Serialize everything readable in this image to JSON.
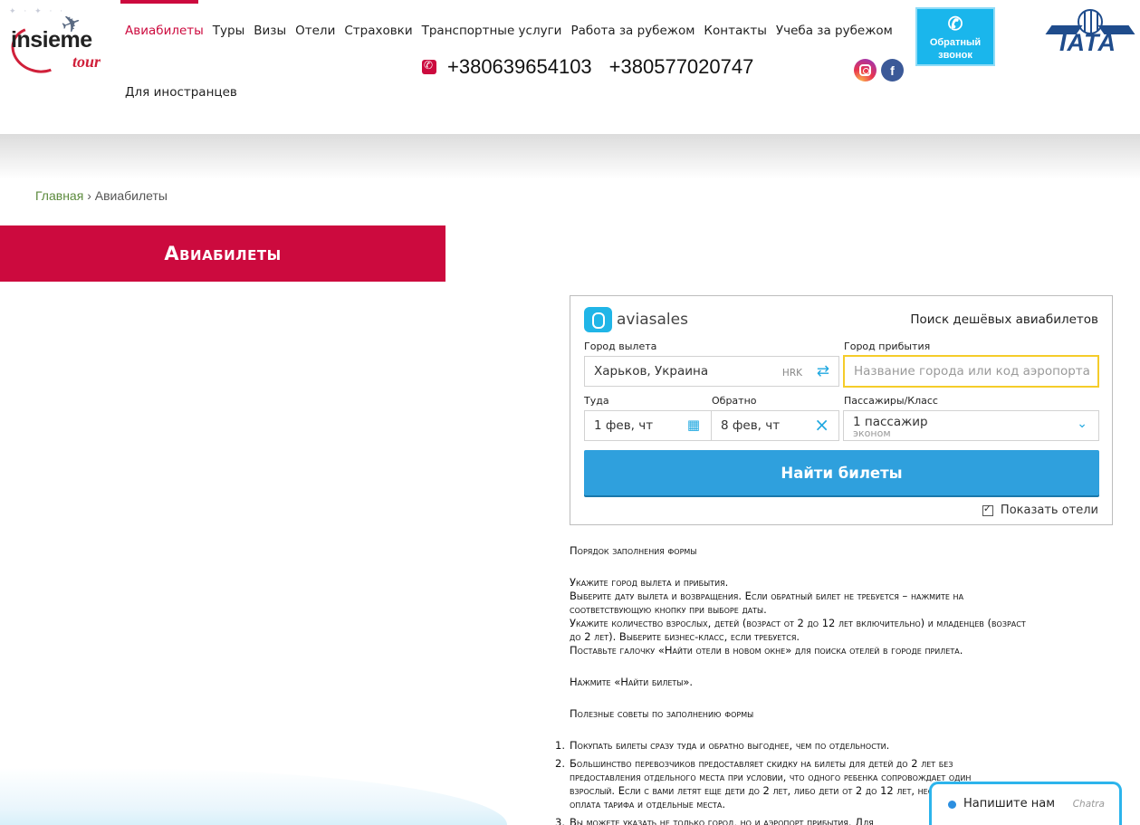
{
  "header": {
    "logo": {
      "brand": "insieme",
      "brand2": "tour"
    },
    "nav": [
      {
        "label": "Авиабилеты",
        "active": true
      },
      {
        "label": "Туры"
      },
      {
        "label": "Визы"
      },
      {
        "label": "Отели"
      },
      {
        "label": "Страховки"
      },
      {
        "label": "Транспортные услуги"
      },
      {
        "label": "Работа за рубежом"
      },
      {
        "label": "Контакты"
      },
      {
        "label": "Учеба за рубежом"
      }
    ],
    "nav_second_row": "Для иностранцев",
    "phones": [
      "+380639654103",
      "+380577020747"
    ],
    "callback": {
      "line1": "Обратный",
      "line2": "звонок"
    },
    "iata_label": "IATA",
    "colors": {
      "accent": "#cc0a3e",
      "callback": "#1ab6ec",
      "iata": "#1f4c8c"
    }
  },
  "breadcrumb": {
    "home": "Главная",
    "separator": "›",
    "current": "Авиабилеты"
  },
  "page_title": "Авиабилеты",
  "widget": {
    "brand": "aviasales",
    "tagline": "Поиск дешёвых авиабилетов",
    "from_label": "Город вылета",
    "from_value": "Харьков, Украина",
    "from_code": "HRK",
    "to_label": "Город прибытия",
    "to_placeholder": "Название города или код аэропорта",
    "depart_label": "Туда",
    "depart_value": "1 фев, чт",
    "return_label": "Обратно",
    "return_value": "8 фев, чт",
    "pax_label": "Пассажиры/Класс",
    "pax_value": "1 пассажир",
    "pax_class": "эконом",
    "search_button": "Найти билеты",
    "show_hotels": "Показать отели",
    "colors": {
      "button": "#2fa0dd",
      "focus_border": "#f5cc2a",
      "icon": "#20a8e0"
    }
  },
  "instructions": {
    "heading": "Порядок заполнения формы",
    "steps": [
      "Укажите город вылета и прибытия.",
      "Выберите дату вылета и возвращения. Если обратный билет не требуется – нажмите на",
      "соответствующую кнопку при выборе даты.",
      "Укажите количество взрослых, детей (возраст от 2 до 12 лет включительно) и младенцев (возраст",
      "до 2 лет). Выберите бизнес-класс, если требуется.",
      "Поставьте галочку «Найти отели в новом окне» для поиска отелей в городе прилета."
    ],
    "press": "Нажмите «Найти билеты».",
    "tips_heading": "Полезные советы по заполнению формы",
    "tips": [
      {
        "num": "1.",
        "lines": [
          "Покупать билеты сразу туда и обратно выгоднее, чем по отдельности."
        ]
      },
      {
        "num": "2.",
        "lines": [
          "Большинство перевозчиков предоставляет скидку на билеты для детей до 2 лет без",
          "предоставления отдельного места при условии, что одного ребенка сопровождает один",
          "взрослый. Если с вами летят еще дети до 2 лет, либо дети от 2 до 12 лет, необходима",
          "оплата тарифа и отдельные места."
        ]
      },
      {
        "num": "3.",
        "lines": [
          "Вы можете указать не только город, но и аэропорт прибытия. Для"
        ]
      }
    ]
  },
  "chat": {
    "message": "Напишите нам",
    "brand": "Chatra"
  }
}
